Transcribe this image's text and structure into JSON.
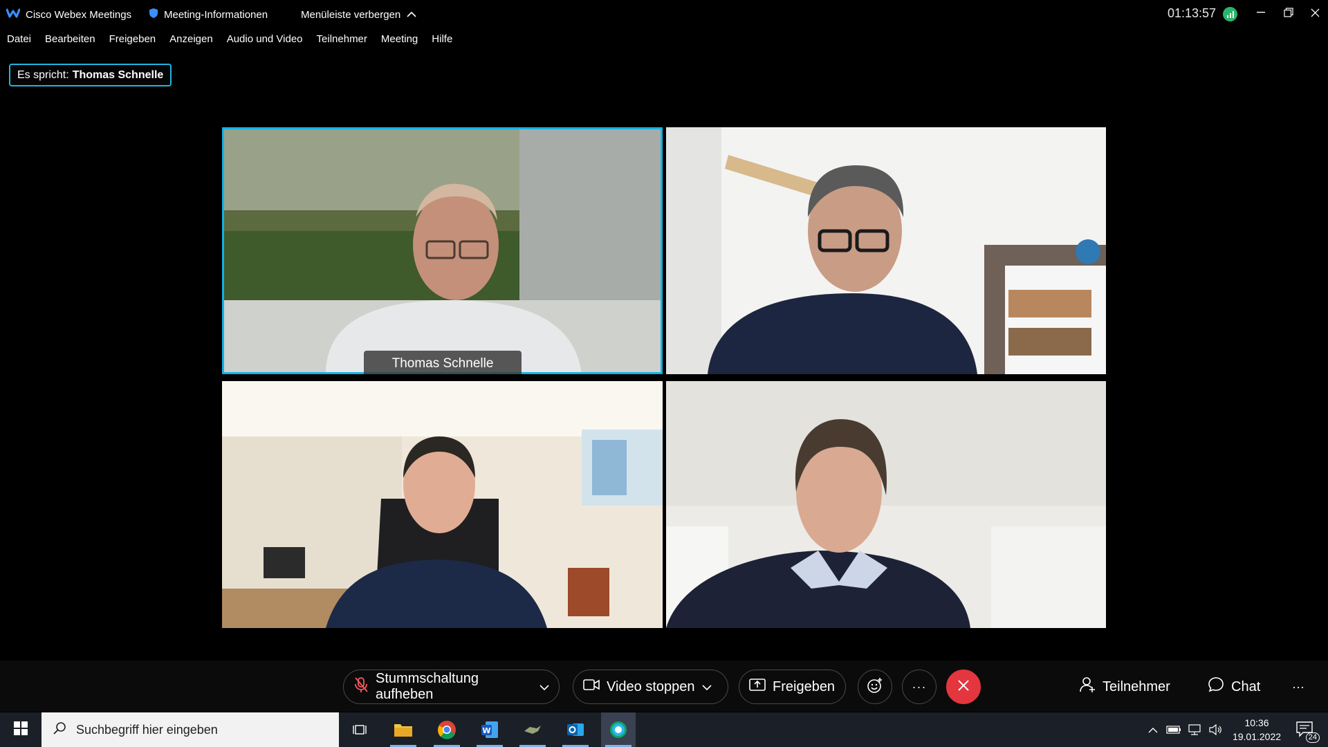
{
  "titlebar": {
    "app_title": "Cisco Webex Meetings",
    "meeting_info": "Meeting-Informationen",
    "hide_menu": "Menüleiste verbergen",
    "timer": "01:13:57"
  },
  "menu": [
    "Datei",
    "Bearbeiten",
    "Freigeben",
    "Anzeigen",
    "Audio und Video",
    "Teilnehmer",
    "Meeting",
    "Hilfe"
  ],
  "speaker": {
    "prefix": "Es spricht:",
    "name": "Thomas Schnelle"
  },
  "tiles": [
    {
      "name": "Thomas Schnelle"
    }
  ],
  "controls": {
    "unmute": "Stummschaltung aufheben",
    "video": "Video stoppen",
    "share": "Freigeben",
    "participants": "Teilnehmer",
    "chat": "Chat",
    "more": "···"
  },
  "taskbar": {
    "search_placeholder": "Suchbegriff hier eingeben",
    "time": "10:36",
    "date": "19.01.2022",
    "notifications": "24"
  },
  "colors": {
    "accent": "#12b3e6",
    "end_call": "#e4363e",
    "signal": "#2bb36b"
  }
}
